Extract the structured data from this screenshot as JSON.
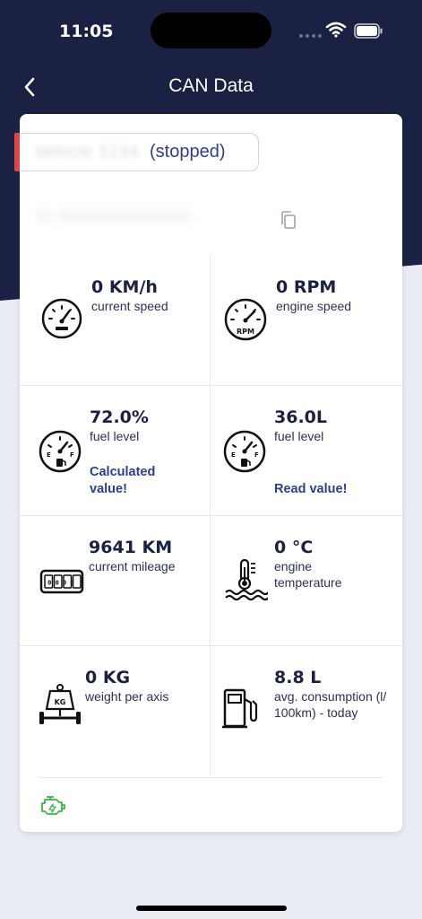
{
  "status_bar": {
    "time": "11:05"
  },
  "nav": {
    "title": "CAN Data"
  },
  "vehicle": {
    "name": "Vehicle 1234",
    "status": "(stopped)",
    "id": "ID 0000000000000"
  },
  "metrics": [
    {
      "value": "0 KM/h",
      "label": "current speed",
      "icon": "speedometer-icon"
    },
    {
      "value": "0 RPM",
      "label": "engine speed",
      "icon": "rpm-gauge-icon"
    },
    {
      "value": "72.0%",
      "label": "fuel level",
      "note": "Calculated value!",
      "icon": "fuel-gauge-icon"
    },
    {
      "value": "36.0L",
      "label": "fuel level",
      "note": "Read value!",
      "icon": "fuel-gauge-icon"
    },
    {
      "value": "9641 KM",
      "label": "current mileage",
      "icon": "odometer-icon"
    },
    {
      "value": "0 °C",
      "label": "engine temperature",
      "icon": "coolant-temperature-icon"
    },
    {
      "value": "0 KG",
      "label": "weight per axis",
      "icon": "axle-weight-icon"
    },
    {
      "value": "8.8 L",
      "label": "avg. consumption (l/ 100km) - today",
      "icon": "fuel-pump-icon"
    }
  ],
  "icons": {
    "rpm_text": "RPM",
    "kg_text": "KG",
    "odometer_digits": "0000"
  },
  "colors": {
    "header": "#1a2142",
    "accent": "#2d3f8f",
    "status_red": "#d94848",
    "engine_green": "#3bb54a"
  }
}
